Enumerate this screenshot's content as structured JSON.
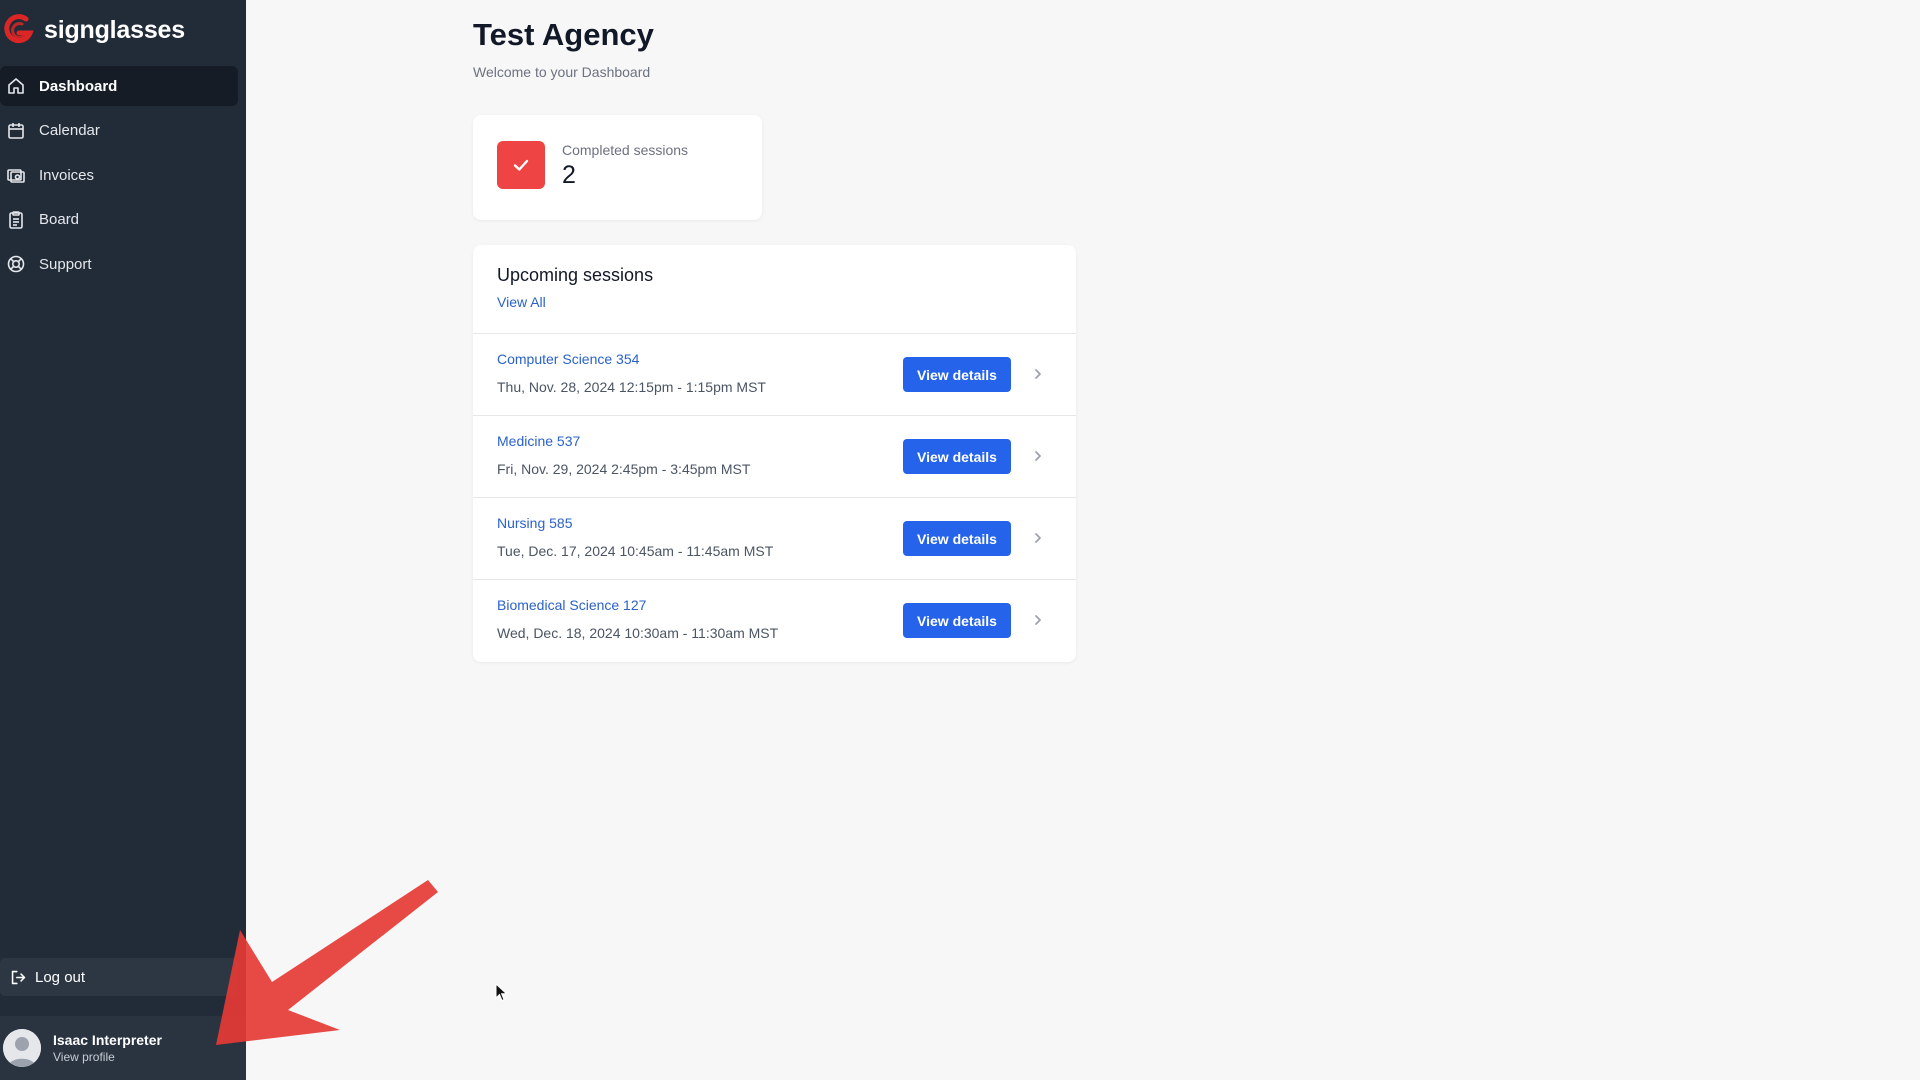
{
  "app": {
    "brand_name": "signglasses",
    "brand_color": "#dc2626"
  },
  "sidebar": {
    "items": [
      {
        "label": "Dashboard",
        "icon": "home-icon",
        "active": true
      },
      {
        "label": "Calendar",
        "icon": "calendar-icon",
        "active": false
      },
      {
        "label": "Invoices",
        "icon": "invoice-icon",
        "active": false
      },
      {
        "label": "Board",
        "icon": "clipboard-icon",
        "active": false
      },
      {
        "label": "Support",
        "icon": "lifebuoy-icon",
        "active": false
      }
    ],
    "logout_label": "Log out",
    "profile": {
      "name": "Isaac Interpreter",
      "link": "View profile"
    }
  },
  "main": {
    "title": "Test Agency",
    "subtitle": "Welcome to your Dashboard",
    "stats": {
      "label": "Completed sessions",
      "value": "2",
      "icon": "check-icon",
      "icon_color": "#ef4444"
    },
    "upcoming": {
      "title": "Upcoming sessions",
      "view_all": "View All",
      "button_label": "View details",
      "rows": [
        {
          "name": "Computer Science 354",
          "time": "Thu, Nov. 28, 2024 12:15pm - 1:15pm MST"
        },
        {
          "name": "Medicine 537",
          "time": "Fri, Nov. 29, 2024 2:45pm - 3:45pm MST"
        },
        {
          "name": "Nursing 585",
          "time": "Tue, Dec. 17, 2024 10:45am - 11:45am MST"
        },
        {
          "name": "Biomedical Science 127",
          "time": "Wed, Dec. 18, 2024 10:30am - 11:30am MST"
        }
      ]
    }
  },
  "colors": {
    "sidebar_bg": "#222c38",
    "accent_blue": "#2563eb",
    "link_blue": "#2b62c8",
    "annotation_red": "#e53935"
  }
}
